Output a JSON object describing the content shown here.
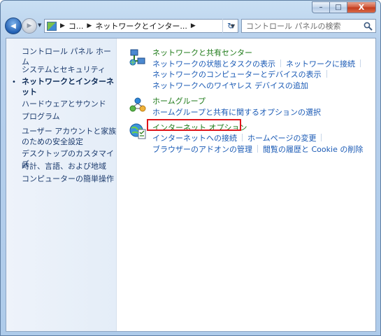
{
  "window": {
    "caption_buttons": {
      "minimize": "–",
      "maximize": "□",
      "close": "X"
    }
  },
  "toolbar": {
    "back_glyph": "◀",
    "forward_glyph": "▶",
    "breadcrumb": [
      "コ...",
      "ネットワークとインター..."
    ],
    "refresh_glyph": "↻",
    "search_placeholder": "コントロール パネルの検索"
  },
  "sidebar": {
    "home": "コントロール パネル ホーム",
    "items": [
      {
        "label": "システムとセキュリティ"
      },
      {
        "label": "ネットワークとインターネット",
        "current": true
      },
      {
        "label": "ハードウェアとサウンド"
      },
      {
        "label": "プログラム"
      },
      {
        "label": "ユーザー アカウントと家族のための安全設定"
      },
      {
        "label": "デスクトップのカスタマイズ"
      },
      {
        "label": "時計、言語、および地域"
      },
      {
        "label": "コンピューターの簡単操作"
      }
    ],
    "bullet": "•"
  },
  "categories": [
    {
      "icon": "network-center-icon",
      "title": "ネットワークと共有センター",
      "rows": [
        [
          "ネットワークの状態とタスクの表示",
          "ネットワークに接続"
        ],
        [
          "ネットワークのコンピューターとデバイスの表示"
        ],
        [
          "ネットワークへのワイヤレス デバイスの追加"
        ]
      ]
    },
    {
      "icon": "homegroup-icon",
      "title": "ホームグループ",
      "rows": [
        [
          "ホームグループと共有に関するオプションの選択"
        ]
      ]
    },
    {
      "icon": "internet-options-icon",
      "title": "インターネット オプション",
      "highlighted": true,
      "rows": [
        [
          "インターネットへの接続",
          "ホームページの変更"
        ],
        [
          "ブラウザーのアドオンの管理",
          "閲覧の履歴と Cookie の削除"
        ]
      ]
    }
  ],
  "colors": {
    "link": "#1a5ab5",
    "category_title": "#1e7a18",
    "highlight": "#e0141a"
  }
}
